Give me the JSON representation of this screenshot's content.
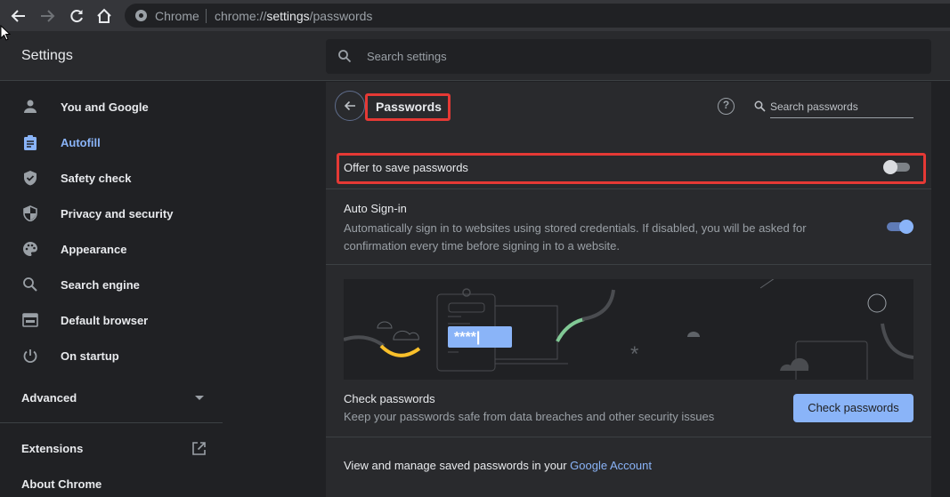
{
  "browser": {
    "omnibox_label": "Chrome",
    "url_prefix": "chrome://",
    "url_host": "settings",
    "url_path": "/passwords"
  },
  "header": {
    "title": "Settings",
    "search_placeholder": "Search settings"
  },
  "sidebar": {
    "items": [
      {
        "label": "You and Google",
        "icon": "person-icon"
      },
      {
        "label": "Autofill",
        "icon": "clipboard-icon",
        "active": true
      },
      {
        "label": "Safety check",
        "icon": "shield-check-icon"
      },
      {
        "label": "Privacy and security",
        "icon": "shield-half-icon"
      },
      {
        "label": "Appearance",
        "icon": "palette-icon"
      },
      {
        "label": "Search engine",
        "icon": "search-icon"
      },
      {
        "label": "Default browser",
        "icon": "browser-window-icon"
      },
      {
        "label": "On startup",
        "icon": "power-icon"
      }
    ],
    "advanced_label": "Advanced",
    "extensions_label": "Extensions",
    "about_label": "About Chrome"
  },
  "passwords": {
    "title": "Passwords",
    "search_placeholder": "Search passwords",
    "offer_to_save": {
      "label": "Offer to save passwords",
      "enabled": false
    },
    "auto_signin": {
      "title": "Auto Sign-in",
      "description": "Automatically sign in to websites using stored credentials. If disabled, you will be asked for confirmation every time before signing in to a website.",
      "enabled": true
    },
    "illustration_text": "****|",
    "check": {
      "title": "Check passwords",
      "description": "Keep your passwords safe from data breaches and other security issues",
      "button_label": "Check passwords"
    },
    "manage": {
      "text": "View and manage saved passwords in your ",
      "link_label": "Google Account"
    }
  },
  "colors": {
    "accent": "#8ab4f8",
    "highlight_border": "#e53935",
    "background": "#202124",
    "card": "#292a2d"
  }
}
